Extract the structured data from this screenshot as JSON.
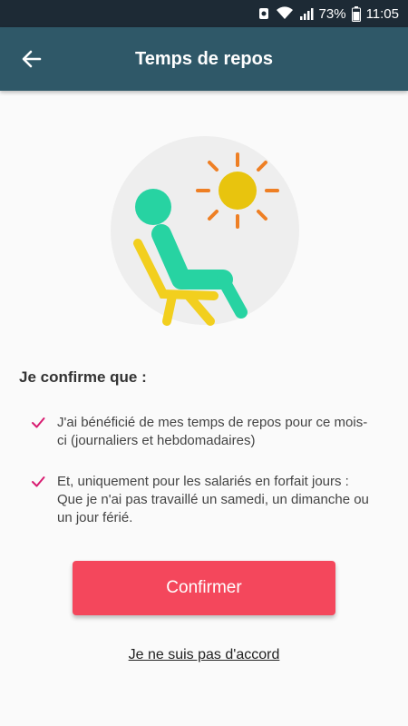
{
  "status_bar": {
    "battery_percent": "73%",
    "time": "11:05",
    "icons": [
      "notification-icon",
      "wifi-icon",
      "signal-icon",
      "battery-icon"
    ]
  },
  "app_bar": {
    "title": "Temps de repos",
    "back_icon": "arrow-left-icon",
    "background": "#2f5868"
  },
  "illustration": {
    "icon": "rest-chair-sun-illustration",
    "colors": {
      "circle": "#eeeeee",
      "person": "#27d3a2",
      "chair": "#f2cf1e",
      "sun": "#e8c40e",
      "rays": "#ee7f24"
    }
  },
  "confirmation": {
    "heading": "Je confirme que :",
    "items": [
      {
        "text": "J'ai bénéficié de mes temps de repos pour ce mois-ci (journaliers et hebdomadaires)"
      },
      {
        "text": "Et, uniquement pour les salariés en forfait jours : Que je n'ai pas travaillé un samedi, un dimanche ou un jour férié."
      }
    ],
    "check_color": "#d81b70"
  },
  "actions": {
    "confirm_label": "Confirmer",
    "confirm_color": "#f4475c",
    "disagree_label": "Je ne suis pas d'accord"
  }
}
